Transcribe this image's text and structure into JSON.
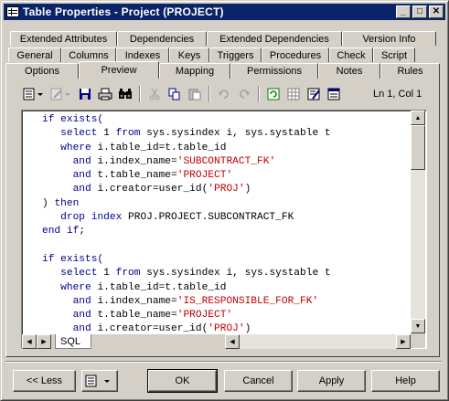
{
  "window": {
    "title": "Table Properties - Project (PROJECT)"
  },
  "titlebar_buttons": {
    "minimize": "_",
    "maximize": "□",
    "close": "✕"
  },
  "tabs": {
    "row1": [
      "Extended Attributes",
      "Dependencies",
      "Extended Dependencies",
      "Version Info"
    ],
    "row2": [
      "General",
      "Columns",
      "Indexes",
      "Keys",
      "Triggers",
      "Procedures",
      "Check",
      "Script"
    ],
    "row3": [
      "Options",
      "Preview",
      "Mapping",
      "Permissions",
      "Notes",
      "Rules"
    ],
    "active": "Preview"
  },
  "toolbar": {
    "icons": [
      "properties-menu-icon",
      "edit-menu-icon",
      "save-icon",
      "print-icon",
      "find-icon",
      "cut-icon",
      "copy-icon",
      "paste-icon",
      "undo-icon",
      "redo-icon",
      "refresh-icon",
      "table-icon",
      "edit-properties-icon",
      "preview-options-icon"
    ],
    "cursor_position": "Ln 1, Col 1"
  },
  "editor": {
    "tab_label": "SQL",
    "lines": [
      [
        [
          "kw",
          "if exists("
        ]
      ],
      [
        [
          "n",
          "   "
        ],
        [
          "kw",
          "select"
        ],
        [
          "n",
          " 1 "
        ],
        [
          "kw",
          "from"
        ],
        [
          "n",
          " sys.sysindex i, sys.systable t"
        ]
      ],
      [
        [
          "n",
          "   "
        ],
        [
          "kw",
          "where"
        ],
        [
          "n",
          " i.table_id=t.table_id"
        ]
      ],
      [
        [
          "n",
          "     "
        ],
        [
          "kw",
          "and"
        ],
        [
          "n",
          " i.index_name="
        ],
        [
          "str",
          "'SUBCONTRACT_FK'"
        ]
      ],
      [
        [
          "n",
          "     "
        ],
        [
          "kw",
          "and"
        ],
        [
          "n",
          " t.table_name="
        ],
        [
          "str",
          "'PROJECT'"
        ]
      ],
      [
        [
          "n",
          "     "
        ],
        [
          "kw",
          "and"
        ],
        [
          "n",
          " i.creator=user_id("
        ],
        [
          "str",
          "'PROJ'"
        ],
        [
          "n",
          ")"
        ]
      ],
      [
        [
          "n",
          ") "
        ],
        [
          "kw",
          "then"
        ]
      ],
      [
        [
          "n",
          "   "
        ],
        [
          "kw",
          "drop index"
        ],
        [
          "n",
          " PROJ.PROJECT.SUBCONTRACT_FK"
        ]
      ],
      [
        [
          "kw",
          "end if"
        ],
        [
          "n",
          ";"
        ]
      ],
      [
        [
          "n",
          ""
        ]
      ],
      [
        [
          "kw",
          "if exists("
        ]
      ],
      [
        [
          "n",
          "   "
        ],
        [
          "kw",
          "select"
        ],
        [
          "n",
          " 1 "
        ],
        [
          "kw",
          "from"
        ],
        [
          "n",
          " sys.sysindex i, sys.systable t"
        ]
      ],
      [
        [
          "n",
          "   "
        ],
        [
          "kw",
          "where"
        ],
        [
          "n",
          " i.table_id=t.table_id"
        ]
      ],
      [
        [
          "n",
          "     "
        ],
        [
          "kw",
          "and"
        ],
        [
          "n",
          " i.index_name="
        ],
        [
          "str",
          "'IS_RESPONSIBLE_FOR_FK'"
        ]
      ],
      [
        [
          "n",
          "     "
        ],
        [
          "kw",
          "and"
        ],
        [
          "n",
          " t.table_name="
        ],
        [
          "str",
          "'PROJECT'"
        ]
      ],
      [
        [
          "n",
          "     "
        ],
        [
          "kw",
          "and"
        ],
        [
          "n",
          " i.creator=user_id("
        ],
        [
          "str",
          "'PROJ'"
        ],
        [
          "n",
          ")"
        ]
      ]
    ]
  },
  "buttons": {
    "less": "<< Less",
    "ok": "OK",
    "cancel": "Cancel",
    "apply": "Apply",
    "help": "Help"
  },
  "colors": {
    "titlebar": "#0a246a",
    "keyword": "#00008b",
    "string": "#c00000",
    "face": "#d4d0c8"
  }
}
